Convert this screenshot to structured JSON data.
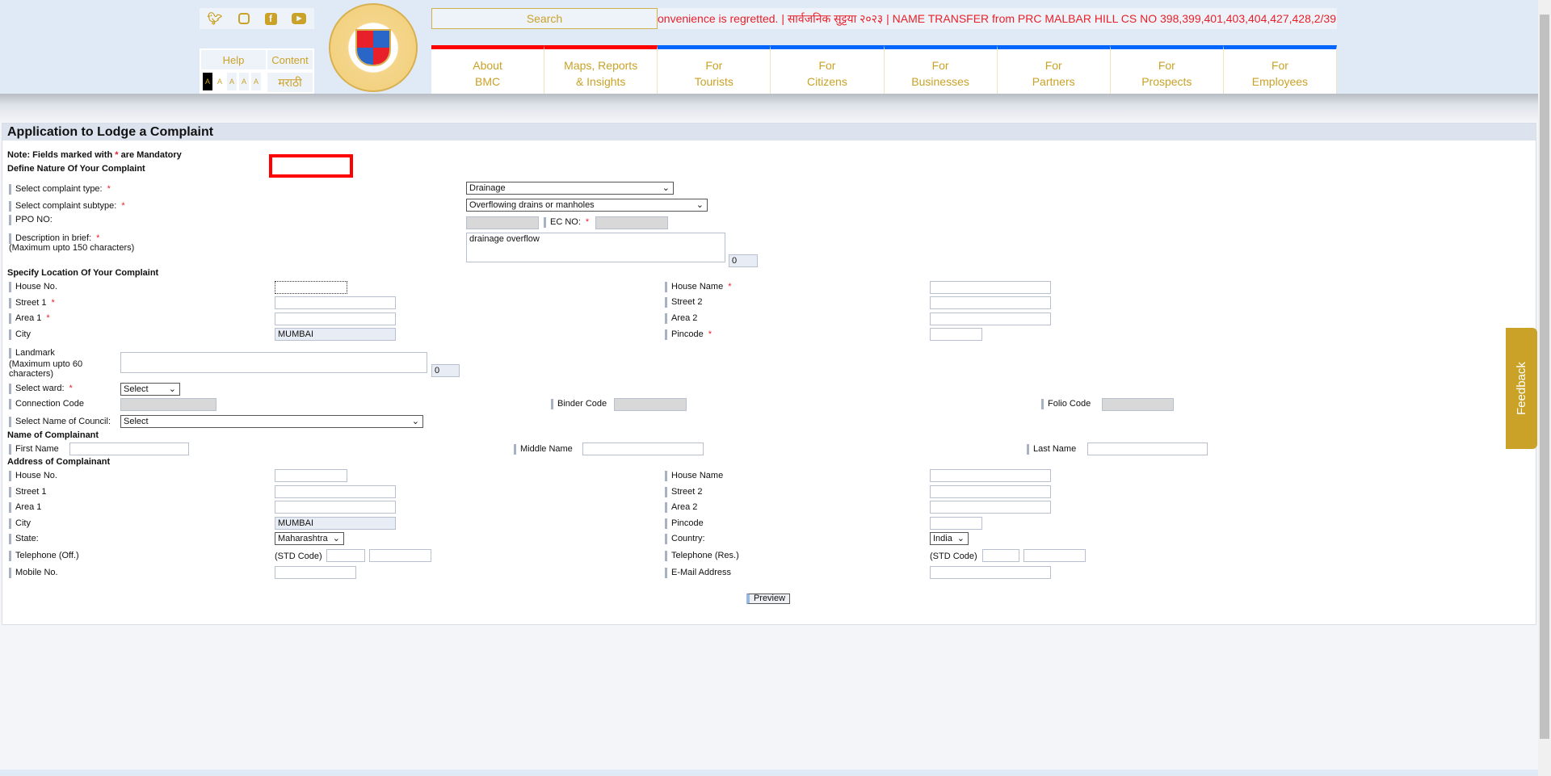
{
  "header": {
    "social": [
      "twitter-icon",
      "instagram-icon",
      "facebook-icon",
      "youtube-icon"
    ],
    "help": "Help",
    "content": "Content",
    "font_sizes": [
      "A",
      "A",
      "A",
      "A",
      "A"
    ],
    "language": "मराठी",
    "search_placeholder": "Search",
    "ticker": "onvenience is regretted. | सार्वजनिक सुट्टया २०२३ | NAME TRANSFER from PRC MALBAR HILL CS NO 398,399,401,403,404,427,428,2/39",
    "logo_text": "बृहन्मुंबई महानगरपालिका · Brihanmumbai Municipal Corporation",
    "nav": [
      {
        "l1": "About",
        "l2": "BMC"
      },
      {
        "l1": "Maps, Reports",
        "l2": "& Insights"
      },
      {
        "l1": "For",
        "l2": "Tourists"
      },
      {
        "l1": "For",
        "l2": "Citizens"
      },
      {
        "l1": "For",
        "l2": "Businesses"
      },
      {
        "l1": "For",
        "l2": "Partners"
      },
      {
        "l1": "For",
        "l2": "Prospects"
      },
      {
        "l1": "For",
        "l2": "Employees"
      }
    ],
    "colors": {
      "accent": "#c9a227",
      "nav_red": "#ff0000",
      "nav_blue": "#0066ff"
    }
  },
  "form": {
    "title": "Application to Lodge a Complaint",
    "note_pre": "Note: Fields marked with",
    "note_star": "*",
    "note_post": "are Mandatory",
    "sec_nature": "Define Nature Of Your Complaint",
    "complaint_type_label": "Select complaint type:",
    "complaint_type": "Drainage",
    "subtype_label": "Select complaint subtype:",
    "subtype": "Overflowing drains or manholes",
    "ppo_label": "PPO NO:",
    "ec_label": "EC NO:",
    "desc_label": "Description in brief:",
    "desc_hint": "(Maximum upto 150 characters)",
    "desc_value": "drainage overflow",
    "desc_count": "0",
    "sec_location": "Specify Location Of Your Complaint",
    "house_no": "House No.",
    "house_name": "House Name",
    "street1": "Street 1",
    "street2": "Street 2",
    "area1": "Area 1",
    "area2": "Area 2",
    "city": "City",
    "city_value": "MUMBAI",
    "pincode": "Pincode",
    "landmark_label": "Landmark",
    "landmark_hint1": "(Maximum upto 60",
    "landmark_hint2": "characters)",
    "landmark_count": "0",
    "ward_label": "Select ward:",
    "ward_value": "Select",
    "connection_code": "Connection Code",
    "binder_code": "Binder Code",
    "folio_code": "Folio Code",
    "council_label": "Select Name of Council:",
    "council_value": "Select",
    "sec_name": "Name of Complainant",
    "first_name": "First Name",
    "middle_name": "Middle Name",
    "last_name": "Last Name",
    "sec_address": "Address of Complainant",
    "state_label": "State:",
    "state_value": "Maharashtra",
    "country_label": "Country:",
    "country_value": "India",
    "tel_off": "Telephone (Off.)",
    "tel_res": "Telephone (Res.)",
    "std_code": "(STD Code)",
    "mobile": "Mobile No.",
    "email": "E-Mail Address",
    "preview": "Preview"
  },
  "feedback": "Feedback"
}
